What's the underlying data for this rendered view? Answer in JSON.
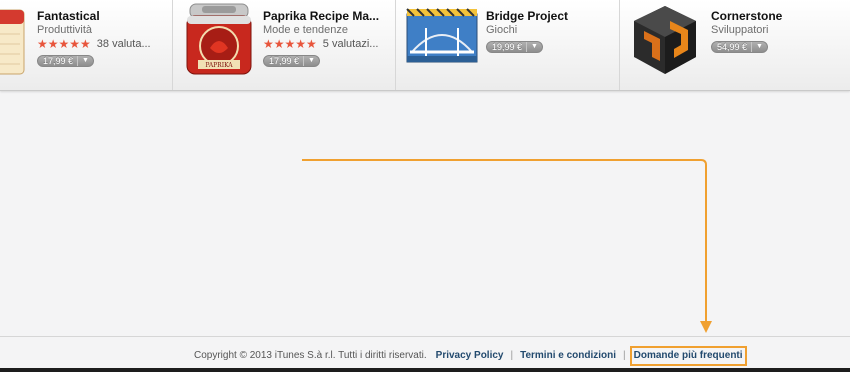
{
  "apps": [
    {
      "name": "Fantastical",
      "category": "Produttività",
      "stars": "★★★★★",
      "rating_count": "38 valuta...",
      "price": "17,99 €",
      "price_arrow": "▼",
      "icon": "calendar-icon"
    },
    {
      "name": "Paprika Recipe Ma...",
      "category": "Mode e tendenze",
      "stars": "★★★★★",
      "rating_count": "5 valutazi...",
      "price": "17,99 €",
      "price_arrow": "▼",
      "icon": "paprika-tin-icon",
      "icon_label": "PAPRIKA"
    },
    {
      "name": "Bridge Project",
      "category": "Giochi",
      "price": "19,99 €",
      "price_arrow": "▼",
      "icon": "bridge-icon"
    },
    {
      "name": "Cornerstone",
      "category": "Sviluppatori",
      "price": "54,99 €",
      "price_arrow": "▼",
      "icon": "cornerstone-cube-icon"
    }
  ],
  "footer": {
    "copyright": "Copyright © 2013 iTunes S.à r.l. Tutti i diritti riservati.",
    "links": {
      "privacy": "Privacy Policy",
      "terms": "Termini e condizioni",
      "faq": "Domande più frequenti"
    },
    "separator": "|"
  },
  "colors": {
    "annotation_orange": "#f0a030",
    "link": "#234a6e",
    "star": "#e8553c"
  }
}
